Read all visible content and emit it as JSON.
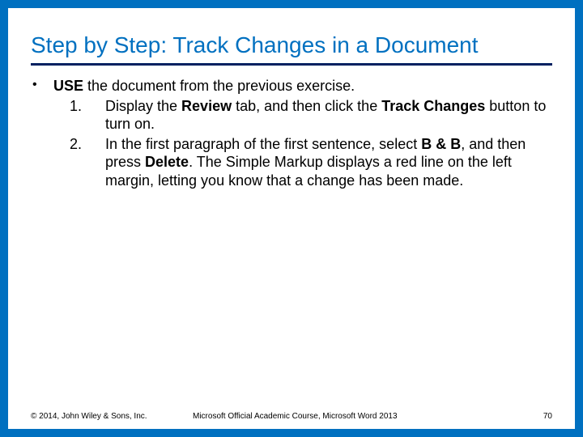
{
  "title": "Step by Step: Track Changes in a Document",
  "lead": {
    "bold": "USE",
    "rest": " the document from the previous exercise."
  },
  "steps": [
    {
      "num": "1.",
      "parts": [
        {
          "t": "Display the "
        },
        {
          "t": "Review",
          "b": true
        },
        {
          "t": " tab, and then click the "
        },
        {
          "t": "Track Changes",
          "b": true
        },
        {
          "t": " button to turn on."
        }
      ]
    },
    {
      "num": "2.",
      "parts": [
        {
          "t": "In the first paragraph of the first sentence, select "
        },
        {
          "t": "B & B",
          "b": true
        },
        {
          "t": ", and then press "
        },
        {
          "t": "Delete",
          "b": true
        },
        {
          "t": ". The Simple Markup displays a red line on the left margin, letting you know that a change has been made."
        }
      ]
    }
  ],
  "footer": {
    "copyright": "© 2014, John Wiley & Sons, Inc.",
    "course": "Microsoft Official Academic Course, Microsoft Word 2013",
    "page": "70"
  },
  "bullet_glyph": "•"
}
